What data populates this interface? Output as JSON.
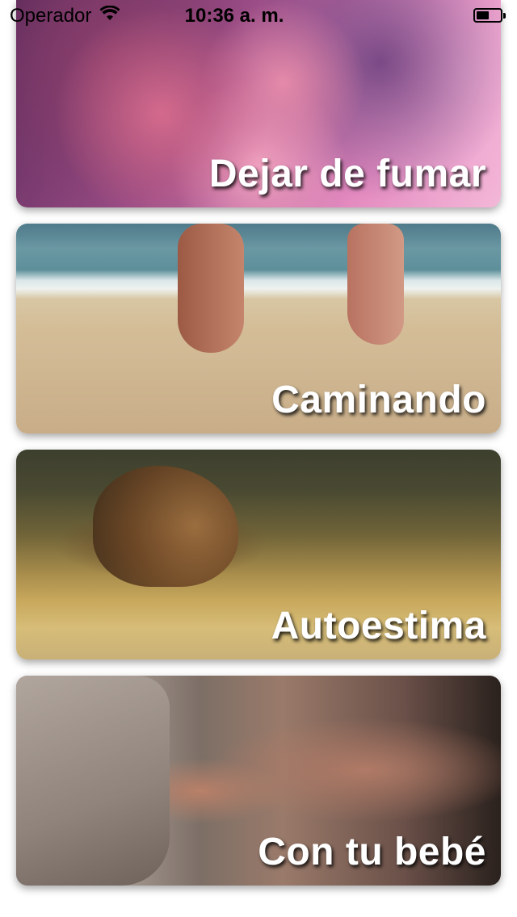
{
  "status_bar": {
    "carrier": "Operador",
    "time": "10:36 a. m.",
    "battery_level": 0.55
  },
  "cards": [
    {
      "title": "Dejar de fumar",
      "image": "pink-smoke"
    },
    {
      "title": "Caminando",
      "image": "feet-on-beach-sand"
    },
    {
      "title": "Autoestima",
      "image": "lion-in-grass"
    },
    {
      "title": "Con tu bebé",
      "image": "father-and-sleeping-baby"
    }
  ],
  "colors": {
    "title_text": "#ffffff",
    "background": "#ffffff"
  }
}
